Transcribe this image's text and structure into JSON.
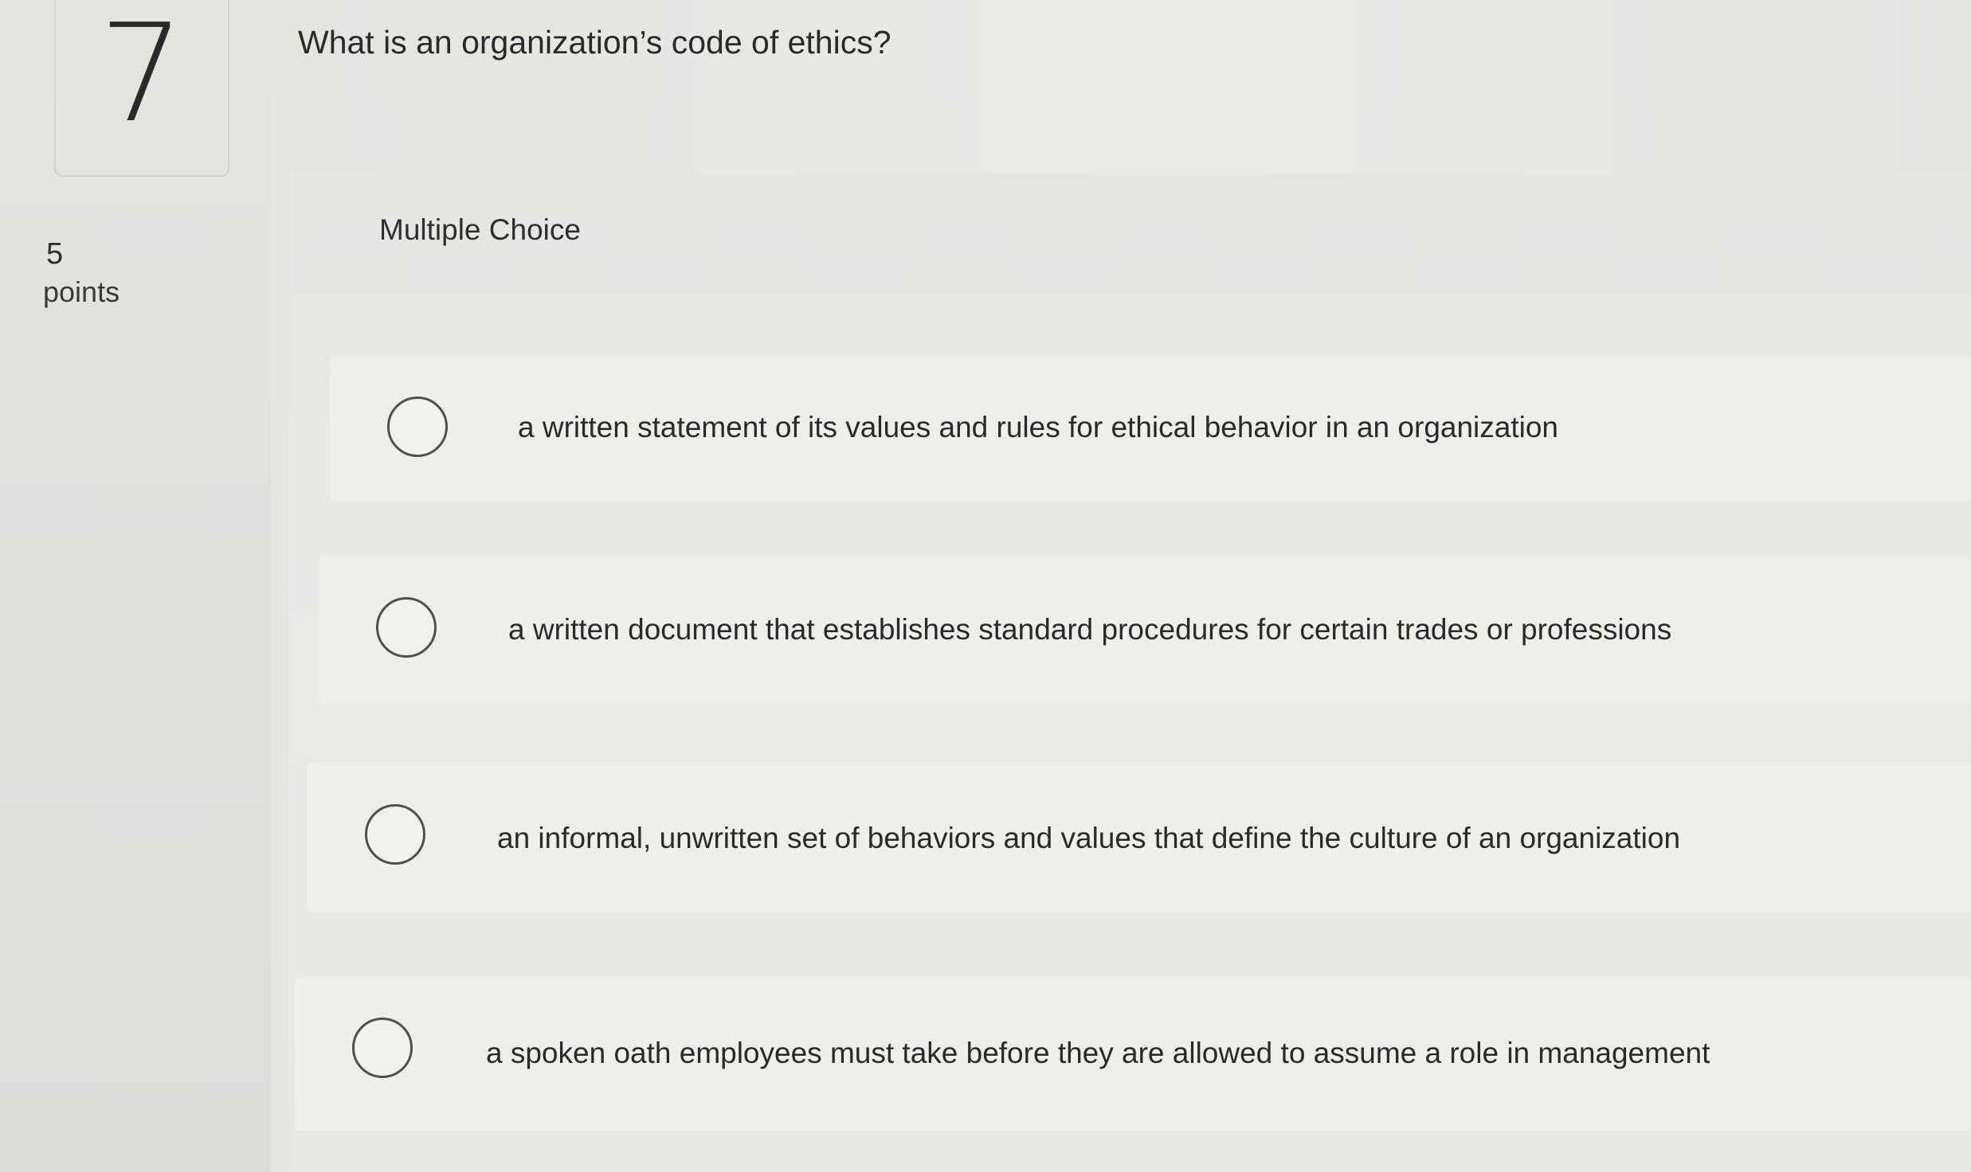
{
  "question": {
    "number": "7",
    "points_value": "5",
    "points_label": "points",
    "text": "What is an organization’s code of ethics?",
    "type_label": "Multiple Choice"
  },
  "choices": [
    {
      "text": "a written statement of its values and rules for ethical behavior in an organization",
      "selected": false
    },
    {
      "text": "a written document that establishes standard procedures for certain trades or professions",
      "selected": false
    },
    {
      "text": "an informal, unwritten set of behaviors and values that define the culture of an organization",
      "selected": false
    },
    {
      "text": "a spoken oath employees must take before they are allowed to assume a role in management",
      "selected": false
    }
  ]
}
